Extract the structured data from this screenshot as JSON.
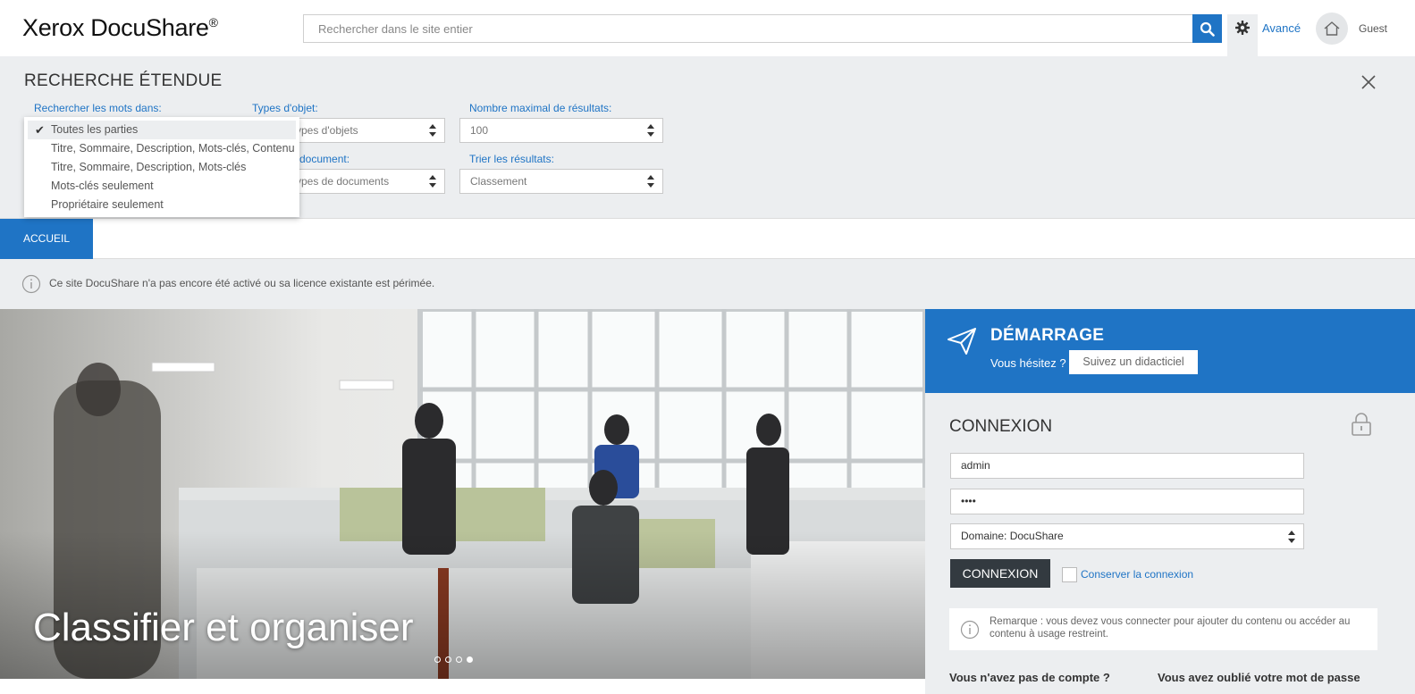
{
  "header": {
    "logo": "Xerox DocuShare",
    "logo_mark": "®",
    "search_placeholder": "Rechercher dans le site entier",
    "advanced_link": "Avancé",
    "user_label": "Guest"
  },
  "advanced_search": {
    "title": "RECHERCHE ÉTENDUE",
    "search_in_label": "Rechercher les mots dans:",
    "object_types_label": "Types d'objet:",
    "object_types_value": "ypes d'objets",
    "doc_types_label": "document:",
    "doc_types_value": "ypes de documents",
    "max_results_label": "Nombre maximal de résultats:",
    "max_results_value": "100",
    "sort_label": "Trier les résultats:",
    "sort_value": "Classement",
    "dropdown_options": [
      "Toutes les parties",
      "Titre, Sommaire, Description, Mots-clés, Contenu",
      "Titre, Sommaire, Description, Mots-clés",
      "Mots-clés seulement",
      "Propriétaire seulement"
    ],
    "selected_option": "Toutes les parties"
  },
  "nav": {
    "home_tab": "ACCUEIL"
  },
  "notice": {
    "text": "Ce site DocuShare n'a pas encore été activé ou sa licence existante est périmée."
  },
  "hero": {
    "caption": "Classifier et organiser",
    "slide_count": 4,
    "active_slide": 4
  },
  "getting_started": {
    "title": "DÉMARRAGE",
    "question": "Vous hésitez ?",
    "button": "Suivez un didacticiel"
  },
  "login": {
    "title": "CONNEXION",
    "username_value": "admin",
    "password_value": "••••",
    "domain_value": "Domaine: DocuShare",
    "submit_label": "CONNEXION",
    "remember_label": "Conserver la connexion",
    "remark": "Remarque : vous devez vous connecter pour ajouter du contenu ou accéder au contenu à usage restreint.",
    "no_account": "Vous n'avez pas de compte ?",
    "forgot_password": "Vous avez oublié votre mot de passe"
  },
  "colors": {
    "accent": "#1f74c5",
    "panel_bg": "#eceef0",
    "dark_button": "#333a40"
  }
}
